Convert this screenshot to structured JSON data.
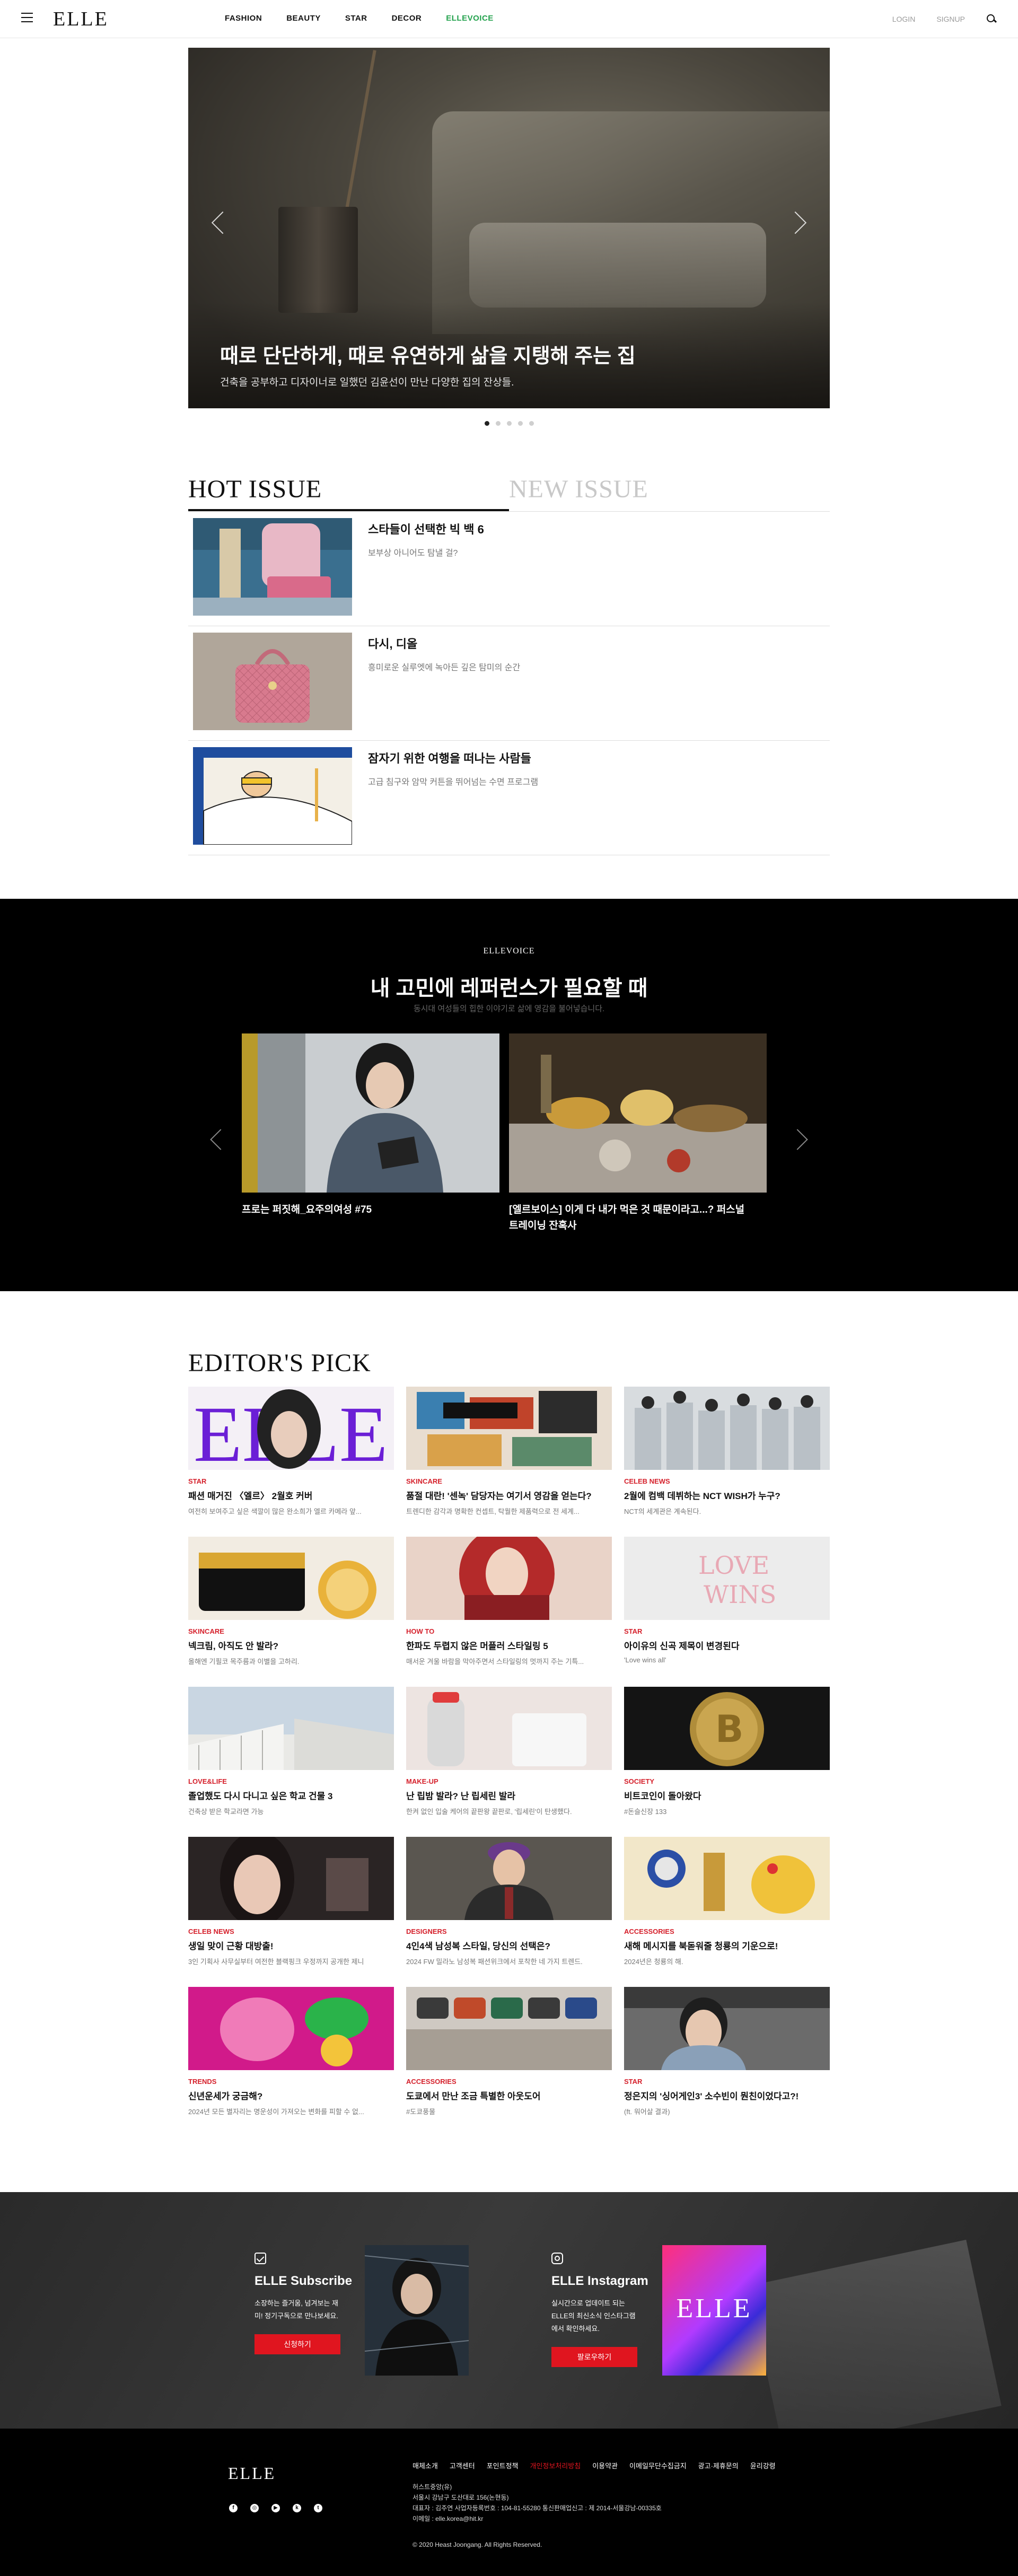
{
  "header": {
    "logo": "ELLE",
    "nav": [
      "FASHION",
      "BEAUTY",
      "STAR",
      "DECOR",
      "ELLEVOICE"
    ],
    "active_nav": "ELLEVOICE",
    "login": "LOGIN",
    "signup": "SIGNUP"
  },
  "hero": {
    "title": "때로 단단하게, 때로 유연하게 삶을 지탱해 주는 집",
    "subtitle": "건축을 공부하고 디자이너로 일했던 김윤선이 만난 다양한 집의 잔상들.",
    "slide_count": 5,
    "active_slide": 1
  },
  "issue": {
    "tab_hot": "HOT ISSUE",
    "tab_new": "NEW ISSUE",
    "items": [
      {
        "title": "스타들이 선택한 빅 백 6",
        "desc": "보부상 아니어도 탐낼 걸?"
      },
      {
        "title": "다시, 디올",
        "desc": "흥미로운 실루엣에 녹아든 깊은 탐미의 순간"
      },
      {
        "title": "잠자기 위한 여행을 떠나는 사람들",
        "desc": "고급 침구와 암막 커튼을 뛰어넘는 수면 프로그램"
      }
    ]
  },
  "voice": {
    "label": "ELLEVOICE",
    "title": "내 고민에 레퍼런스가 필요할 때",
    "subtitle": "동시대 여성들의 힙한 이야기로 삶에 영감을 불어넣습니다.",
    "cards": [
      {
        "caption": "프로는 퍼짓해_요주의여성 #75"
      },
      {
        "caption_line1": "[엘르보이스] 이게 다 내가 먹은 것 때문이라고...? 퍼스널",
        "caption_line2": "트레이닝 잔혹사"
      }
    ]
  },
  "picks": {
    "title": "EDITOR'S PICK",
    "cards": [
      {
        "cat": "STAR",
        "title": "패션 매거진 〈엘르〉 2월호 커버",
        "desc": "여전히 보여주고 싶은 색깔이 많은 완소희가 엘르 카메라 앞..."
      },
      {
        "cat": "SKINCARE",
        "title": "품절 대란! '센녹' 담당자는 여기서 영감을 얻는다?",
        "desc": "트렌디한 감각과 명확한 컨셉트, 탁월한 제품력으로 전 세계..."
      },
      {
        "cat": "CELEB NEWS",
        "title": "2월에 컴백 데뷔하는 NCT WISH가 누구?",
        "desc": "NCT의 세계관은 계속된다."
      },
      {
        "cat": "SKINCARE",
        "title": "넥크림, 아직도 안 발라?",
        "desc": "올해엔 기필코 목주름과 이별을 고하리."
      },
      {
        "cat": "HOW TO",
        "title": "한파도 두렵지 않은 머플러 스타일링 5",
        "desc": "매서운 겨울 바람을 막아주면서 스타일링의 멋까지 주는 기특..."
      },
      {
        "cat": "STAR",
        "title": "아이유의 신곡 제목이 변경된다",
        "desc": "'Love wins all'"
      },
      {
        "cat": "LOVE&LIFE",
        "title": "졸업했도 다시 다니고 싶은 학교 건물 3",
        "desc": "건축상 받은 학교라면 가능"
      },
      {
        "cat": "MAKE-UP",
        "title": "난 립밤 발라? 난 립세린 발라",
        "desc": "한켜 없인 입술 케어의 끝판왕 끝판로, '립세린'이 탄생했다."
      },
      {
        "cat": "SOCIETY",
        "title": "비트코인이 돌아왔다",
        "desc": "#돈슬신장 133"
      },
      {
        "cat": "CELEB NEWS",
        "title": "생일 맞이 근황 대방출!",
        "desc": "3인 기획사 사무실부터 여전한 블랙핑크 우정까지 공개한 제니"
      },
      {
        "cat": "DESIGNERS",
        "title": "4인4색 남성복 스타일, 당신의 선택은?",
        "desc": "2024 FW 밀라노 남성복 패션위크에서 포착한 네 가지 트렌드."
      },
      {
        "cat": "ACCESSORIES",
        "title": "새해 메시지를 북돋워줄 청룡의 기운으로!",
        "desc": "2024년은 청룡의 해."
      },
      {
        "cat": "TRENDS",
        "title": "신년운세가 궁금해?",
        "desc": "2024년 모든 별자리는 명운성이 가져오는 변화를 피할 수 없..."
      },
      {
        "cat": "ACCESSORIES",
        "title": "도쿄에서 만난 조금 특별한 아웃도어",
        "desc": "#도쿄풍물"
      },
      {
        "cat": "STAR",
        "title": "정은지의 '싱어게인3' 소수빈이 뭔친이었다고?!",
        "desc": "(ft. 워어살 결과)"
      }
    ]
  },
  "subscribe": {
    "sub_title": "ELLE Subscribe",
    "sub_desc": "소장하는 즐거움, 넘겨보는 재미! 정기구독으로 만나보세요.",
    "sub_btn": "신청하기",
    "insta_title": "ELLE Instagram",
    "insta_desc": "실시간으로 업데이트 되는 ELLE의 최신소식 인스타그램에서 확인하세요.",
    "insta_btn": "팔로우하기",
    "insta_logo": "ELLE"
  },
  "footer": {
    "logo": "ELLE",
    "links": [
      "매체소개",
      "고객센터",
      "포인트정책",
      "개인정보처리방침",
      "이용약관",
      "이메일무단수집금지",
      "광고·제휴문의",
      "윤리강령"
    ],
    "red_link": "개인정보처리방침",
    "info1": "허스트중앙(유)",
    "info2": "서울시 강남구 도산대로 156(논현동)",
    "info3": "대표자 : 김주연 사업자등록번호 : 104-81-55280 통신판매업신고 : 제 2014-서울강남-00335호",
    "info4": "이메일 : elle.korea@hit.kr",
    "copyright": "© 2020 Heast Joongang. All Rights Reserved."
  }
}
